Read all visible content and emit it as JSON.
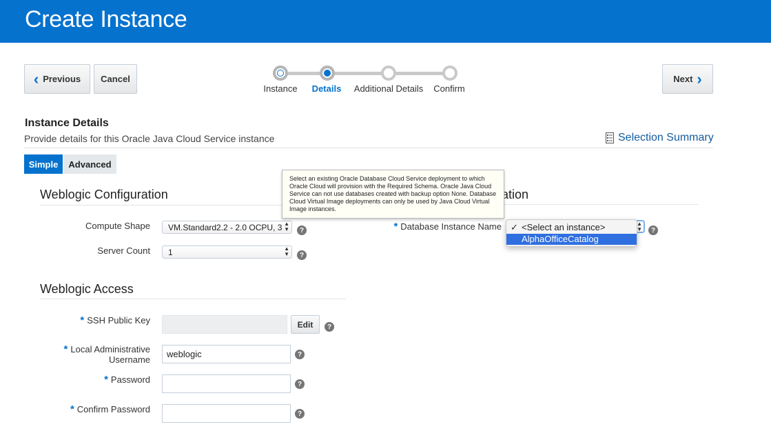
{
  "header": {
    "title": "Create Instance"
  },
  "nav": {
    "previous_label": "Previous",
    "cancel_label": "Cancel",
    "next_label": "Next"
  },
  "train": {
    "steps": [
      {
        "label": "Instance",
        "state": "visited"
      },
      {
        "label": "Details",
        "state": "current"
      },
      {
        "label": "Additional Details",
        "state": "unvisited"
      },
      {
        "label": "Confirm",
        "state": "unvisited"
      }
    ]
  },
  "details": {
    "title": "Instance Details",
    "description": "Provide details for this Oracle Java Cloud Service instance",
    "summary_link": "Selection Summary"
  },
  "tabs": {
    "simple": "Simple",
    "advanced": "Advanced",
    "active": "Simple"
  },
  "weblogic_config": {
    "title": "Weblogic Configuration",
    "compute_shape_label": "Compute Shape",
    "compute_shape_value": "VM.Standard2.2 - 2.0 OCPU, 3",
    "server_count_label": "Server Count",
    "server_count_value": "1"
  },
  "weblogic_access": {
    "title": "Weblogic Access",
    "ssh_key_label": "SSH Public Key",
    "ssh_key_value": "",
    "edit_label": "Edit",
    "admin_user_label_1": "Local Administrative",
    "admin_user_label_2": "Username",
    "admin_user_value": "weblogic",
    "password_label": "Password",
    "confirm_password_label": "Confirm Password"
  },
  "database_config": {
    "title_visible_fragment": "ation",
    "db_instance_label": "Database Instance Name",
    "options": [
      "<Select an instance>",
      "AlphaOfficeCatalog"
    ],
    "selected_option": "<Select an instance>",
    "highlighted_option": "AlphaOfficeCatalog"
  },
  "tooltip": {
    "text": "Select an existing Oracle Database Cloud Service deployment to which Oracle Cloud will provision with the Required Schema. Oracle Java Cloud Service can not use databases created with backup option None. Database Cloud Virtual Image deployments can only be used by Java Cloud Virtual Image instances."
  },
  "icons": {
    "previous": "chevron-left-icon",
    "next": "chevron-right-icon",
    "summary": "checklist-icon",
    "help": "help-icon",
    "check": "checkmark-icon"
  },
  "colors": {
    "brand": "#0572ce",
    "highlight": "#2f6fe0"
  }
}
